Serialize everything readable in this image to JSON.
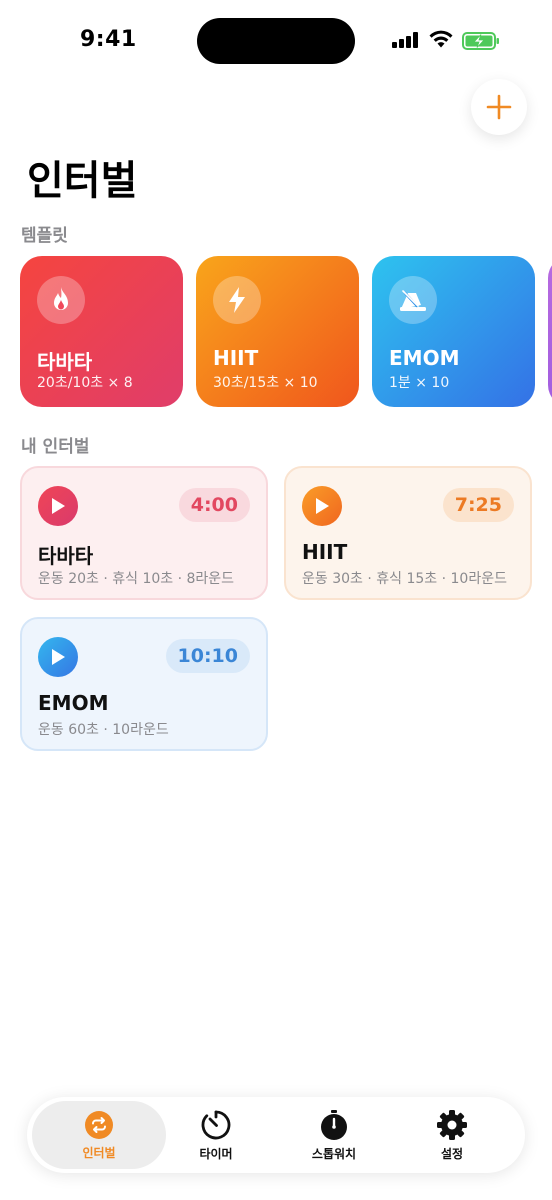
{
  "status_bar": {
    "time": "9:41"
  },
  "header": {
    "title": "인터벌"
  },
  "sections": {
    "templates": "템플릿",
    "my_intervals": "내 인터벌"
  },
  "templates": [
    {
      "name": "타바타",
      "detail": "20초/10초 × 8",
      "icon": "flame-icon",
      "color": "#f5453f"
    },
    {
      "name": "HIIT",
      "detail": "30초/15초 × 10",
      "icon": "bolt-icon",
      "color": "#f9a51b"
    },
    {
      "name": "EMOM",
      "detail": "1분 × 10",
      "icon": "metronome-icon",
      "color": "#2ec3ef"
    }
  ],
  "my_intervals": [
    {
      "name": "타바타",
      "duration": "4:00",
      "detail": "운동 20초 · 휴식 10초 · 8라운드",
      "accent": "#e24860"
    },
    {
      "name": "HIIT",
      "duration": "7:25",
      "detail": "운동 30초 · 휴식 15초 · 10라운드",
      "accent": "#ec7a24"
    },
    {
      "name": "EMOM",
      "duration": "10:10",
      "detail": "운동 60초 · 10라운드",
      "accent": "#3b86d6"
    }
  ],
  "tabbar": {
    "items": [
      {
        "label": "인터벌",
        "icon": "repeat-icon",
        "active": true
      },
      {
        "label": "타이머",
        "icon": "timer-icon",
        "active": false
      },
      {
        "label": "스톱워치",
        "icon": "stopwatch-icon",
        "active": false
      },
      {
        "label": "설정",
        "icon": "gear-icon",
        "active": false
      }
    ]
  },
  "colors": {
    "accent": "#f08a24"
  }
}
